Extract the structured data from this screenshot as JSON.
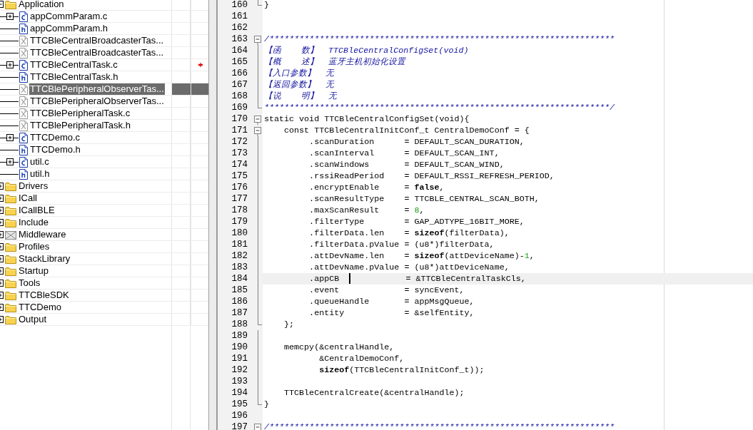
{
  "project_tree": [
    {
      "label": "Application",
      "kind": "folder",
      "expanded": true,
      "selected": false,
      "children": [
        {
          "label": "appCommParam.c",
          "kind": "c-file",
          "expanded": false,
          "selected": false,
          "modified": false
        },
        {
          "label": "appCommParam.h",
          "kind": "h-file",
          "selected": false,
          "modified": false
        },
        {
          "label": "TTCBleCentralBroadcasterTas...",
          "kind": "excluded-file",
          "selected": false,
          "modified": false
        },
        {
          "label": "TTCBleCentralBroadcasterTas...",
          "kind": "excluded-file",
          "selected": false,
          "modified": false
        },
        {
          "label": "TTCBleCentralTask.c",
          "kind": "c-file",
          "expanded": false,
          "selected": false,
          "modified": true
        },
        {
          "label": "TTCBleCentralTask.h",
          "kind": "h-file",
          "selected": false,
          "modified": false
        },
        {
          "label": "TTCBlePeripheralObserverTas...",
          "kind": "excluded-file",
          "selected": true,
          "modified": false
        },
        {
          "label": "TTCBlePeripheralObserverTas...",
          "kind": "excluded-file",
          "selected": false,
          "modified": false
        },
        {
          "label": "TTCBlePeripheralTask.c",
          "kind": "excluded-file",
          "selected": false,
          "modified": false
        },
        {
          "label": "TTCBlePeripheralTask.h",
          "kind": "excluded-file",
          "selected": false,
          "modified": false
        },
        {
          "label": "TTCDemo.c",
          "kind": "c-file",
          "expanded": false,
          "selected": false,
          "modified": false
        },
        {
          "label": "TTCDemo.h",
          "kind": "h-file",
          "selected": false,
          "modified": false
        },
        {
          "label": "util.c",
          "kind": "c-file",
          "expanded": false,
          "selected": false,
          "modified": false
        },
        {
          "label": "util.h",
          "kind": "h-file",
          "selected": false,
          "modified": false
        }
      ]
    },
    {
      "label": "Drivers",
      "kind": "folder",
      "expanded": false,
      "selected": false
    },
    {
      "label": "ICall",
      "kind": "folder",
      "expanded": false,
      "selected": false
    },
    {
      "label": "ICallBLE",
      "kind": "folder",
      "expanded": false,
      "selected": false
    },
    {
      "label": "Include",
      "kind": "folder",
      "expanded": false,
      "selected": false
    },
    {
      "label": "Middleware",
      "kind": "excluded-folder",
      "expanded": false,
      "selected": false
    },
    {
      "label": "Profiles",
      "kind": "folder",
      "expanded": false,
      "selected": false
    },
    {
      "label": "StackLibrary",
      "kind": "folder",
      "expanded": false,
      "selected": false
    },
    {
      "label": "Startup",
      "kind": "folder",
      "expanded": false,
      "selected": false
    },
    {
      "label": "Tools",
      "kind": "folder",
      "expanded": false,
      "selected": false
    },
    {
      "label": "TTCBleSDK",
      "kind": "folder",
      "expanded": false,
      "selected": false
    },
    {
      "label": "TTCDemo",
      "kind": "folder",
      "expanded": false,
      "selected": false
    },
    {
      "label": "Output",
      "kind": "folder",
      "expanded": false,
      "selected": false
    }
  ],
  "editor": {
    "lines": [
      {
        "number": "160",
        "kind": "fold-end",
        "current": false,
        "segments": [
          {
            "kind": "plain",
            "text": "}"
          }
        ]
      },
      {
        "number": "161",
        "current": false
      },
      {
        "number": "162",
        "current": false
      },
      {
        "number": "163",
        "kind": "fold-start",
        "current": false,
        "segments": [
          {
            "kind": "comment",
            "text": "/*********************************************************************"
          }
        ]
      },
      {
        "number": "164",
        "kind": "fold-line",
        "current": false,
        "segments": [
          {
            "kind": "comment",
            "text": "【函    数】  TTCBleCentralConfigSet(void)"
          }
        ]
      },
      {
        "number": "165",
        "kind": "fold-line",
        "current": false,
        "segments": [
          {
            "kind": "comment",
            "text": "【概    述】  蓝牙主机初始化设置"
          }
        ]
      },
      {
        "number": "166",
        "kind": "fold-line",
        "current": false,
        "segments": [
          {
            "kind": "comment",
            "text": "【入口参数】  无"
          }
        ]
      },
      {
        "number": "167",
        "kind": "fold-line",
        "current": false,
        "segments": [
          {
            "kind": "comment",
            "text": "【返回参数】  无"
          }
        ]
      },
      {
        "number": "168",
        "kind": "fold-line",
        "current": false,
        "segments": [
          {
            "kind": "comment",
            "text": "【说    明】  无"
          }
        ]
      },
      {
        "number": "169",
        "kind": "fold-end",
        "current": false,
        "segments": [
          {
            "kind": "comment",
            "text": "*********************************************************************/"
          }
        ]
      },
      {
        "number": "170",
        "kind": "fold-start",
        "current": false,
        "segments": [
          {
            "kind": "plain",
            "text": "static void TTCBleCentralConfigSet(void){"
          }
        ]
      },
      {
        "number": "171",
        "kind": "fold-start",
        "current": false,
        "segments": [
          {
            "kind": "plain",
            "text": "    const TTCBleCentralInitConf_t CentralDemoConf = {"
          }
        ]
      },
      {
        "number": "172",
        "kind": "fold-line",
        "current": false,
        "segments": [
          {
            "kind": "plain",
            "text": "         .scanDuration      = DEFAULT_SCAN_DURATION,"
          }
        ]
      },
      {
        "number": "173",
        "kind": "fold-line",
        "current": false,
        "segments": [
          {
            "kind": "plain",
            "text": "         .scanInterval      = DEFAULT_SCAN_INT,"
          }
        ]
      },
      {
        "number": "174",
        "kind": "fold-line",
        "current": false,
        "segments": [
          {
            "kind": "plain",
            "text": "         .scanWindows       = DEFAULT_SCAN_WIND,"
          }
        ]
      },
      {
        "number": "175",
        "kind": "fold-line",
        "current": false,
        "segments": [
          {
            "kind": "plain",
            "text": "         .rssiReadPeriod    = DEFAULT_RSSI_REFRESH_PERIOD,"
          }
        ]
      },
      {
        "number": "176",
        "kind": "fold-line",
        "current": false,
        "segments": [
          {
            "kind": "plain",
            "text": "         .encryptEnable     = "
          },
          {
            "kind": "keyword",
            "text": "false"
          },
          {
            "kind": "plain",
            "text": ","
          }
        ]
      },
      {
        "number": "177",
        "kind": "fold-line",
        "current": false,
        "segments": [
          {
            "kind": "plain",
            "text": "         .scanResultType    = TTCBLE_CENTRAL_SCAN_BOTH,"
          }
        ]
      },
      {
        "number": "178",
        "kind": "fold-line",
        "current": false,
        "segments": [
          {
            "kind": "plain",
            "text": "         .maxScanResult     = "
          },
          {
            "kind": "number",
            "text": "8"
          },
          {
            "kind": "plain",
            "text": ","
          }
        ]
      },
      {
        "number": "179",
        "kind": "fold-line",
        "current": false,
        "segments": [
          {
            "kind": "plain",
            "text": "         .filterType        = GAP_ADTYPE_16BIT_MORE,"
          }
        ]
      },
      {
        "number": "180",
        "kind": "fold-line",
        "current": false,
        "segments": [
          {
            "kind": "plain",
            "text": "         .filterData.len    = "
          },
          {
            "kind": "keyword",
            "text": "sizeof"
          },
          {
            "kind": "plain",
            "text": "(filterData),"
          }
        ]
      },
      {
        "number": "181",
        "kind": "fold-line",
        "current": false,
        "segments": [
          {
            "kind": "plain",
            "text": "         .filterData.pValue = (u8*)filterData,"
          }
        ]
      },
      {
        "number": "182",
        "kind": "fold-line",
        "current": false,
        "segments": [
          {
            "kind": "plain",
            "text": "         .attDevName.len    = "
          },
          {
            "kind": "keyword",
            "text": "sizeof"
          },
          {
            "kind": "plain",
            "text": "(attDeviceName)-"
          },
          {
            "kind": "number",
            "text": "1"
          },
          {
            "kind": "plain",
            "text": ","
          }
        ]
      },
      {
        "number": "183",
        "kind": "fold-line",
        "current": false,
        "segments": [
          {
            "kind": "plain",
            "text": "         .attDevName.pValue = (u8*)attDeviceName,"
          }
        ]
      },
      {
        "number": "184",
        "kind": "fold-line",
        "current": true,
        "segments": [
          {
            "kind": "plain",
            "text": "         .appCB  ",
            "caret_after": true
          },
          {
            "kind": "plain",
            "text": "           = &TTCBleCentralTaskCls,"
          }
        ]
      },
      {
        "number": "185",
        "kind": "fold-line",
        "current": false,
        "segments": [
          {
            "kind": "plain",
            "text": "         .event             = syncEvent,"
          }
        ]
      },
      {
        "number": "186",
        "kind": "fold-line",
        "current": false,
        "segments": [
          {
            "kind": "plain",
            "text": "         .queueHandle       = appMsgQueue,"
          }
        ]
      },
      {
        "number": "187",
        "kind": "fold-line",
        "current": false,
        "segments": [
          {
            "kind": "plain",
            "text": "         .entity            = &selfEntity,"
          }
        ]
      },
      {
        "number": "188",
        "kind": "fold-end",
        "current": false,
        "segments": [
          {
            "kind": "plain",
            "text": "    };"
          }
        ]
      },
      {
        "number": "189",
        "kind": "fold-line",
        "current": false
      },
      {
        "number": "190",
        "kind": "fold-line",
        "current": false,
        "segments": [
          {
            "kind": "plain",
            "text": "    memcpy(&centralHandle,"
          }
        ]
      },
      {
        "number": "191",
        "kind": "fold-line",
        "current": false,
        "segments": [
          {
            "kind": "plain",
            "text": "           &CentralDemoConf,"
          }
        ]
      },
      {
        "number": "192",
        "kind": "fold-line",
        "current": false,
        "segments": [
          {
            "kind": "keyword",
            "text": "           sizeof"
          },
          {
            "kind": "plain",
            "text": "(TTCBleCentralInitConf_t));"
          }
        ]
      },
      {
        "number": "193",
        "kind": "fold-line",
        "current": false
      },
      {
        "number": "194",
        "kind": "fold-line",
        "current": false,
        "segments": [
          {
            "kind": "plain",
            "text": "    TTCBleCentralCreate(&centralHandle);"
          }
        ]
      },
      {
        "number": "195",
        "kind": "fold-end",
        "current": false,
        "segments": [
          {
            "kind": "plain",
            "text": "}"
          }
        ]
      },
      {
        "number": "196",
        "current": false
      },
      {
        "number": "197",
        "kind": "fold-start",
        "current": false,
        "segments": [
          {
            "kind": "comment",
            "text": "/*********************************************************************"
          }
        ]
      }
    ]
  }
}
